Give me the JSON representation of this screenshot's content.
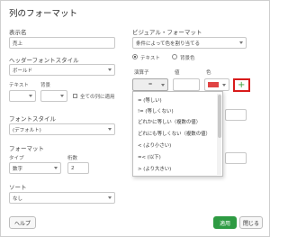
{
  "title": "列のフォーマット",
  "left": {
    "display_name_label": "表示名",
    "display_name_value": "売上",
    "header_font_style_label": "ヘッダーフォントスタイル",
    "header_font_style_value": "ボールド",
    "text_label": "テキスト",
    "background_label": "背景",
    "apply_all_label": "全ての列に適用",
    "font_style_label": "フォントスタイル",
    "font_style_value": "(デフォルト)",
    "format_label": "フォーマット",
    "type_label": "タイプ",
    "digits_label": "桁数",
    "type_value": "数字",
    "digits_value": "2",
    "sort_label": "ソート",
    "sort_value": "なし"
  },
  "right": {
    "visual_format_label": "ビジュアル・フォーマット",
    "visual_format_value": "条件によって色を割り当てる",
    "radio_text": "テキスト",
    "radio_background": "背景色",
    "operator_header": "演算子",
    "value_header": "値",
    "color_header": "色",
    "operator_value": "=",
    "color_value": "#e04343",
    "add_button": "+"
  },
  "operator_options": [
    "= (等しい)",
    "!= (等しくない)",
    "どれかに等しい（複数の値）",
    "どれにも等しくない（複数の値）",
    "< (より小さい)",
    "=< (以下)",
    "> (より大きい)"
  ],
  "footer": {
    "help": "ヘルプ",
    "apply": "適用",
    "close": "閉じる"
  }
}
